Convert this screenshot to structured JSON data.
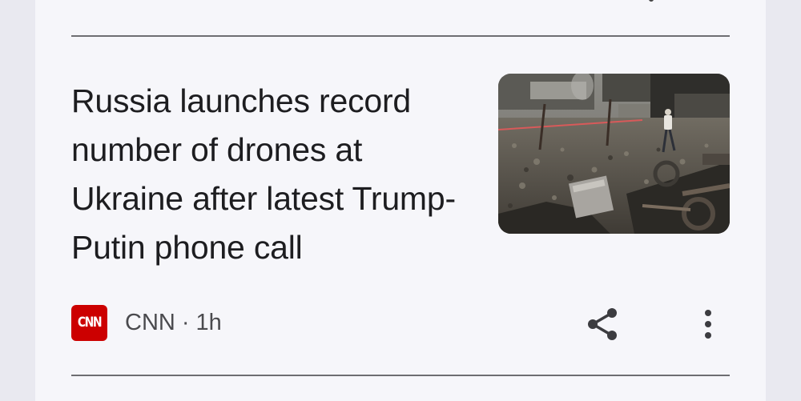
{
  "article": {
    "headline": "Russia launches record number of drones at Ukraine after latest Trump-Putin phone call",
    "source": {
      "logo_text": "CNN",
      "name": "CNN",
      "separator": "·",
      "age": "1h"
    },
    "thumbnail_icon": "news-photo-destroyed-site"
  },
  "actions": {
    "share_icon": "share-icon",
    "more_icon": "more-vert-icon"
  },
  "colors": {
    "card_background": "#f6f6fa",
    "page_background": "#e9e9f0",
    "headline_text": "#1d1d20",
    "meta_text": "#4a4a4e",
    "divider": "#6e6e72",
    "cnn_red": "#cc0000"
  }
}
